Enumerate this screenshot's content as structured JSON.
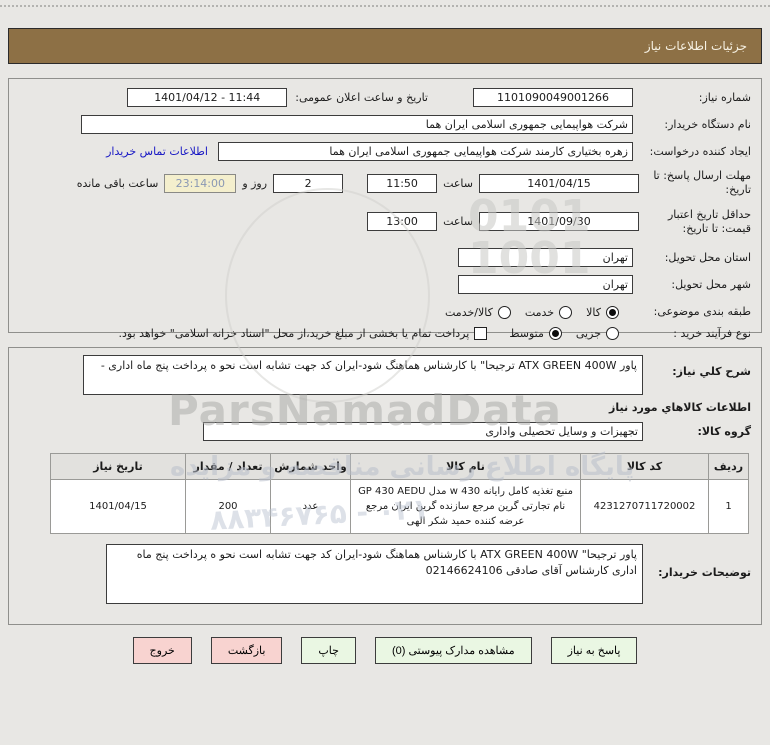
{
  "header": {
    "title": "جزئیات اطلاعات نیاز"
  },
  "panel1": {
    "need_number": {
      "label": "شماره نیاز:",
      "value": "1101090049001266"
    },
    "announce": {
      "label": "تاریخ و ساعت اعلان عمومی:",
      "value": "1401/04/12 - 11:44"
    },
    "buyer_org": {
      "label": "نام دستگاه خریدار:",
      "value": "شرکت هواپیمایی جمهوری اسلامی ایران هما"
    },
    "request_creator": {
      "label": "ایجاد کننده درخواست:",
      "value": "زهره بختیاری کارمند شرکت هواپیمایی جمهوری اسلامی ایران هما",
      "link": "اطلاعات تماس خریدار"
    },
    "deadline": {
      "label": "مهلت ارسال پاسخ: تا تاریخ:",
      "date": "1401/04/15",
      "hour_label": "ساعت",
      "time": "11:50",
      "days": "2",
      "days_label": "روز و",
      "countdown": "23:14:00",
      "remaining_label": "ساعت باقی مانده"
    },
    "validity": {
      "label": "حداقل تاریخ اعتبار قیمت: تا تاریخ:",
      "date": "1401/09/30",
      "hour_label": "ساعت",
      "time": "13:00"
    },
    "province": {
      "label": "استان محل تحویل:",
      "value": "تهران"
    },
    "city": {
      "label": "شهر محل تحویل:",
      "value": "تهران"
    },
    "classification": {
      "label": "طبقه بندی موضوعی:",
      "options": [
        {
          "label": "کالا",
          "selected": true
        },
        {
          "label": "خدمت",
          "selected": false
        },
        {
          "label": "کالا/خدمت",
          "selected": false
        }
      ]
    },
    "process_type": {
      "label": "نوع فرآیند خرید :",
      "options": [
        {
          "label": "جزیی",
          "selected": false
        },
        {
          "label": "متوسط",
          "selected": true
        }
      ],
      "checkbox_label": "پرداخت تمام یا بخشی از مبلغ خرید،از محل \"اسناد خزانه اسلامی\" خواهد بود.",
      "checkbox_checked": false
    }
  },
  "panel2": {
    "description": {
      "label": "شرح کلي نیاز:",
      "value": "پاور ATX GREEN 400W ترجیحا\"  با کارشناس هماهنگ شود-ایران کد جهت تشابه است نحو ه پرداخت پنج ماه اداری -"
    },
    "goods_info_title": "اطلاعات کالاهاي مورد نیاز",
    "goods_group": {
      "label": "گروه کالا:",
      "value": "تجهیزات و وسایل تحصیلی واداری"
    },
    "table": {
      "headers": [
        "ردیف",
        "کد کالا",
        "نام کالا",
        "واحد شمارش",
        "تعداد / مقدار",
        "تاریخ نیاز"
      ],
      "rows": [
        [
          "1",
          "4231270711720002",
          "منبع تغذیه کامل رایانه 430 w مدل GP 430 AEDU نام تجارتی گرین مرجع سازنده گرین ایران مرجع عرضه کننده حمید شکر الهی",
          "عدد",
          "200",
          "1401/04/15"
        ]
      ]
    },
    "buyer_notes": {
      "label": "توضیحات خریدار:",
      "value": "پاور ترجیحا\" ATX GREEN 400W  با کارشناس هماهنگ شود-ایران کد جهت تشابه است نحو ه پرداخت پنج ماه اداری کارشناس آقای صادقی 02146624106"
    }
  },
  "buttons": [
    {
      "label": "پاسخ به نیاز",
      "style": "green"
    },
    {
      "label": "مشاهده مدارک پیوستی (0)",
      "style": "green"
    },
    {
      "label": "چاپ",
      "style": "green"
    },
    {
      "label": "بازگشت",
      "style": "red"
    },
    {
      "label": "خروج",
      "style": "red"
    }
  ],
  "watermark": {
    "brand": "ParsNamadData",
    "fa_line": "پایگاه اطلاع رسانی مناقصه و مزایده",
    "phone": "۸۸۳۴۶۷۶۵ - ۰۲۱",
    "digits1": "0101",
    "digits2": "1001"
  },
  "colors": {
    "title_bar": "#8d7045",
    "button_green": "#eaf7e3",
    "button_red": "#f8d3d0",
    "countdown_bg": "#f4efcd",
    "countdown_text": "#8a98b4",
    "link_blue": "#1717c4",
    "page_bg": "#e8e7e4"
  }
}
